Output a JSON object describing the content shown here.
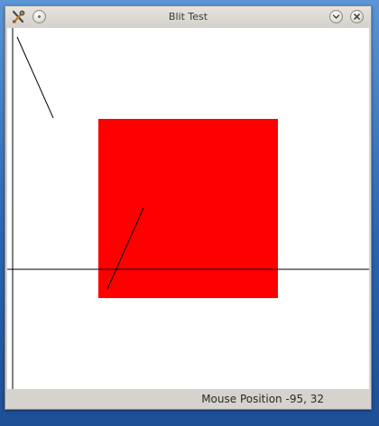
{
  "window": {
    "title": "Blit Test"
  },
  "titlebar": {
    "app_icon": "tools-icon",
    "menu_icon": "window-menu-icon",
    "minimize_icon": "chevron-down-icon",
    "close_icon": "close-icon"
  },
  "canvas": {
    "background": "#ffffff",
    "rect_color": "#ff0000",
    "line_color": "#000000"
  },
  "status": {
    "label": "Mouse Position",
    "value": "-95, 32"
  }
}
